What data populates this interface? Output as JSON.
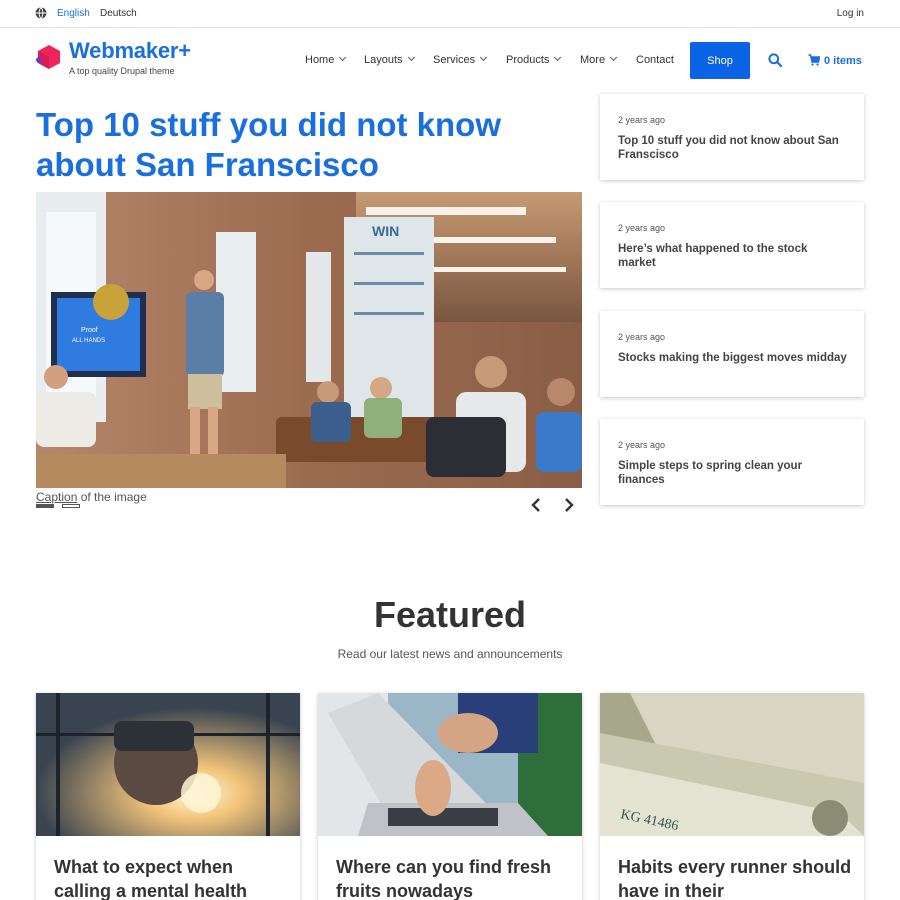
{
  "topbar": {
    "languages": [
      "English",
      "Deutsch"
    ],
    "active_language": "English",
    "login_label": "Log in"
  },
  "header": {
    "brand": "Webmaker+",
    "tagline": "A top quality Drupal theme",
    "nav": [
      {
        "label": "Home",
        "dropdown": true
      },
      {
        "label": "Layouts",
        "dropdown": true
      },
      {
        "label": "Services",
        "dropdown": true
      },
      {
        "label": "Products",
        "dropdown": true
      },
      {
        "label": "More",
        "dropdown": true
      },
      {
        "label": "Contact",
        "dropdown": false
      }
    ],
    "shop_label": "Shop",
    "cart_label": "0 items"
  },
  "hero": {
    "title": "Top 10 stuff you did not know about San Franscisco",
    "caption_word": "Caption",
    "caption_rest": " of the image",
    "slides": 2,
    "active_slide": 1
  },
  "side_articles": [
    {
      "date": "2 years ago",
      "title": "Top 10 stuff you did not know about San Franscisco"
    },
    {
      "date": "2 years ago",
      "title": "Here’s what happened to the stock market"
    },
    {
      "date": "2 years ago",
      "title": "Stocks making the biggest moves midday"
    },
    {
      "date": "2 years ago",
      "title": "Simple steps to spring clean your finances"
    }
  ],
  "featured": {
    "heading": "Featured",
    "subheading": "Read our latest news and announcements",
    "cards": [
      {
        "title": "What to expect when calling a mental health"
      },
      {
        "title": "Where can you find fresh fruits nowadays"
      },
      {
        "title": "Habits every runner should have in their"
      }
    ]
  },
  "colors": {
    "accent": "#1a6fe0",
    "shop_button": "#0b63e5",
    "logo": "#f0245c"
  }
}
